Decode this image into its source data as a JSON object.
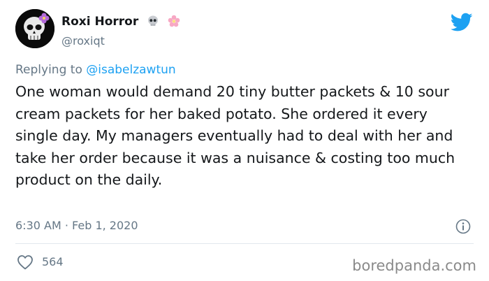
{
  "author": {
    "display_name": "Roxi Horror",
    "handle": "@roxiqt",
    "name_emojis": [
      "skull-icon",
      "cherry-blossom-icon"
    ],
    "avatar_icon": "skull-with-flower-avatar"
  },
  "reply": {
    "prefix": "Replying to ",
    "mention": "@isabelzawtun"
  },
  "tweet": {
    "text": "One woman would demand 20 tiny butter packets & 10 sour cream packets for her baked potato. She ordered it every single day. My managers eventually had to deal with her and take her order because it was a nuisance & costing too much product on the daily."
  },
  "meta": {
    "timestamp": "6:30 AM · Feb 1, 2020",
    "likes": "564"
  },
  "watermark": "boredpanda.com",
  "colors": {
    "twitter_blue": "#1da1f2",
    "secondary_text": "#657786",
    "primary_text": "#14171a"
  }
}
